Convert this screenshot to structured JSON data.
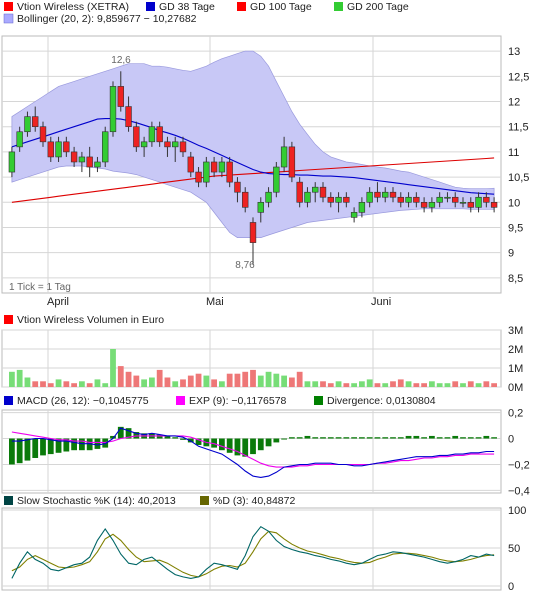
{
  "legends": {
    "price": [
      {
        "color": "#ff0000",
        "label": "Vtion Wireless (XETRA)"
      },
      {
        "color": "#0000cc",
        "label": "GD 38 Tage"
      },
      {
        "color": "#ff0000",
        "label": "GD 100 Tage"
      },
      {
        "color": "#33cc33",
        "label": "GD 200 Tage"
      },
      {
        "color": "#aaaaff",
        "label": "Bollinger (20, 2): 9,859677 − 10,27682"
      }
    ],
    "volume": [
      {
        "color": "#ff0000",
        "label": "Vtion Wireless Volumen in Euro"
      }
    ],
    "macd": [
      {
        "color": "#0000cc",
        "label": "MACD (26, 12): −0,1045775"
      },
      {
        "color": "#ff00ff",
        "label": "EXP (9): −0,1176578"
      },
      {
        "color": "#008000",
        "label": "Divergence: 0,0130804"
      }
    ],
    "stoch": [
      {
        "color": "#004444",
        "label": "Slow Stochastic %K (14): 40,2013"
      },
      {
        "color": "#666600",
        "label": "%D (3): 40,84872"
      }
    ]
  },
  "x_axis": {
    "months": [
      "April",
      "Mai",
      "Juni"
    ]
  },
  "price_axis": {
    "ticks": [
      "13",
      "12,5",
      "12",
      "11,5",
      "11",
      "10,5",
      "10",
      "9,5",
      "9",
      "8,5"
    ]
  },
  "annotations": {
    "high": "12,6",
    "low": "8,76",
    "tick_note": "1 Tick = 1 Tag"
  },
  "volume_axis": {
    "ticks": [
      "3M",
      "2M",
      "1M",
      "0M"
    ]
  },
  "macd_axis": {
    "ticks": [
      "0,2",
      "0",
      "−0,2",
      "−0,4"
    ]
  },
  "stoch_axis": {
    "ticks": [
      "100",
      "50",
      "0"
    ]
  },
  "chart_data": [
    {
      "type": "candlestick",
      "title": "Vtion Wireless (XETRA)",
      "ylim": [
        8.2,
        13.3
      ],
      "candles": [
        [
          10.6,
          11.1,
          10.5,
          11.0
        ],
        [
          11.1,
          11.5,
          11.0,
          11.4
        ],
        [
          11.4,
          11.8,
          11.3,
          11.7
        ],
        [
          11.7,
          11.9,
          11.4,
          11.5
        ],
        [
          11.5,
          11.6,
          11.1,
          11.2
        ],
        [
          11.2,
          11.3,
          10.8,
          10.9
        ],
        [
          10.9,
          11.3,
          10.8,
          11.2
        ],
        [
          11.2,
          11.3,
          10.9,
          11.0
        ],
        [
          11.0,
          11.1,
          10.7,
          10.8
        ],
        [
          10.8,
          11.0,
          10.6,
          10.9
        ],
        [
          10.9,
          11.1,
          10.5,
          10.7
        ],
        [
          10.7,
          10.9,
          10.6,
          10.8
        ],
        [
          10.8,
          11.5,
          10.7,
          11.4
        ],
        [
          11.4,
          12.4,
          11.3,
          12.3
        ],
        [
          12.3,
          12.6,
          11.8,
          11.9
        ],
        [
          11.9,
          12.1,
          11.4,
          11.5
        ],
        [
          11.5,
          11.6,
          11.0,
          11.1
        ],
        [
          11.1,
          11.3,
          10.9,
          11.2
        ],
        [
          11.2,
          11.6,
          11.1,
          11.5
        ],
        [
          11.5,
          11.6,
          11.1,
          11.2
        ],
        [
          11.2,
          11.3,
          10.9,
          11.1
        ],
        [
          11.1,
          11.3,
          10.8,
          11.2
        ],
        [
          11.2,
          11.3,
          10.9,
          11.0
        ],
        [
          10.9,
          11.0,
          10.5,
          10.6
        ],
        [
          10.6,
          10.7,
          10.3,
          10.4
        ],
        [
          10.4,
          10.9,
          10.3,
          10.8
        ],
        [
          10.8,
          10.9,
          10.5,
          10.6
        ],
        [
          10.6,
          10.9,
          10.5,
          10.8
        ],
        [
          10.8,
          10.9,
          10.3,
          10.4
        ],
        [
          10.4,
          10.5,
          10.0,
          10.2
        ],
        [
          10.2,
          10.3,
          9.8,
          9.9
        ],
        [
          9.6,
          9.7,
          8.76,
          9.2
        ],
        [
          9.8,
          10.1,
          9.6,
          10.0
        ],
        [
          10.0,
          10.3,
          9.9,
          10.2
        ],
        [
          10.2,
          10.8,
          10.1,
          10.7
        ],
        [
          10.7,
          11.3,
          10.6,
          11.1
        ],
        [
          11.1,
          11.2,
          10.4,
          10.5
        ],
        [
          10.4,
          10.5,
          9.9,
          10.0
        ],
        [
          10.0,
          10.3,
          9.9,
          10.2
        ],
        [
          10.2,
          10.4,
          10.0,
          10.3
        ],
        [
          10.3,
          10.4,
          10.0,
          10.1
        ],
        [
          10.1,
          10.2,
          9.9,
          10.0
        ],
        [
          10.0,
          10.2,
          9.8,
          10.1
        ],
        [
          10.1,
          10.2,
          9.9,
          10.0
        ],
        [
          9.7,
          9.9,
          9.6,
          9.8
        ],
        [
          9.8,
          10.1,
          9.7,
          10.0
        ],
        [
          10.0,
          10.3,
          9.9,
          10.2
        ],
        [
          10.2,
          10.4,
          10.0,
          10.1
        ],
        [
          10.1,
          10.3,
          10.0,
          10.2
        ],
        [
          10.2,
          10.3,
          10.0,
          10.1
        ],
        [
          10.1,
          10.2,
          9.9,
          10.0
        ],
        [
          10.0,
          10.2,
          9.9,
          10.1
        ],
        [
          10.1,
          10.2,
          9.9,
          10.0
        ],
        [
          10.0,
          10.1,
          9.8,
          9.9
        ],
        [
          9.9,
          10.1,
          9.8,
          10.0
        ],
        [
          10.0,
          10.2,
          9.9,
          10.1
        ],
        [
          10.1,
          10.2,
          10.0,
          10.1
        ],
        [
          10.1,
          10.2,
          9.9,
          10.0
        ],
        [
          10.0,
          10.1,
          9.9,
          10.0
        ],
        [
          10.0,
          10.1,
          9.8,
          9.9
        ],
        [
          9.9,
          10.2,
          9.8,
          10.1
        ],
        [
          10.1,
          10.2,
          9.9,
          10.0
        ],
        [
          10.0,
          10.1,
          9.8,
          9.9
        ]
      ],
      "gd38": [
        11.1,
        11.15,
        11.2,
        11.25,
        11.3,
        11.35,
        11.4,
        11.45,
        11.5,
        11.55,
        11.6,
        11.65,
        11.66,
        11.66,
        11.65,
        11.62,
        11.58,
        11.53,
        11.48,
        11.42,
        11.38,
        11.33,
        11.27,
        11.2,
        11.13,
        11.07,
        11.0,
        10.93,
        10.86,
        10.79,
        10.72,
        10.65,
        10.6,
        10.57,
        10.56,
        10.55,
        10.55,
        10.54,
        10.54,
        10.53,
        10.52,
        10.52,
        10.51,
        10.5,
        10.49,
        10.47,
        10.45,
        10.43,
        10.41,
        10.39,
        10.37,
        10.35,
        10.33,
        10.31,
        10.29,
        10.27,
        10.25,
        10.23,
        10.21,
        10.19,
        10.18,
        10.17,
        10.16
      ],
      "gd100": [
        10.0,
        10.02,
        10.04,
        10.06,
        10.08,
        10.1,
        10.12,
        10.14,
        10.16,
        10.18,
        10.2,
        10.22,
        10.24,
        10.26,
        10.28,
        10.3,
        10.32,
        10.34,
        10.36,
        10.38,
        10.4,
        10.42,
        10.44,
        10.46,
        10.48,
        10.5,
        10.52,
        10.53,
        10.54,
        10.55,
        10.56,
        10.57,
        10.58,
        10.59,
        10.6,
        10.61,
        10.62,
        10.63,
        10.64,
        10.65,
        10.66,
        10.67,
        10.68,
        10.69,
        10.7,
        10.71,
        10.72,
        10.73,
        10.74,
        10.75,
        10.76,
        10.77,
        10.78,
        10.79,
        10.8,
        10.81,
        10.82,
        10.83,
        10.84,
        10.85,
        10.86,
        10.87,
        10.88
      ],
      "boll_upper": [
        11.7,
        11.8,
        11.9,
        12.0,
        12.1,
        12.2,
        12.3,
        12.35,
        12.4,
        12.45,
        12.5,
        12.55,
        12.6,
        12.65,
        12.7,
        12.75,
        12.75,
        12.75,
        12.7,
        12.7,
        12.68,
        12.65,
        12.62,
        12.6,
        12.65,
        12.7,
        12.78,
        12.85,
        12.9,
        12.95,
        13.0,
        13.0,
        12.9,
        12.7,
        12.4,
        12.1,
        11.8,
        11.55,
        11.35,
        11.15,
        11.0,
        10.9,
        10.85,
        10.8,
        10.78,
        10.75,
        10.72,
        10.7,
        10.68,
        10.65,
        10.62,
        10.6,
        10.55,
        10.5,
        10.45,
        10.4,
        10.35,
        10.3,
        10.28,
        10.27,
        10.27,
        10.27,
        10.28
      ],
      "boll_lower": [
        10.4,
        10.45,
        10.5,
        10.55,
        10.6,
        10.65,
        10.7,
        10.72,
        10.72,
        10.72,
        10.7,
        10.68,
        10.66,
        10.62,
        10.6,
        10.58,
        10.55,
        10.5,
        10.45,
        10.4,
        10.35,
        10.3,
        10.25,
        10.2,
        10.1,
        10.0,
        9.8,
        9.6,
        9.4,
        9.3,
        9.3,
        9.3,
        9.3,
        9.35,
        9.4,
        9.45,
        9.5,
        9.55,
        9.6,
        9.62,
        9.64,
        9.66,
        9.68,
        9.7,
        9.72,
        9.74,
        9.76,
        9.78,
        9.8,
        9.82,
        9.84,
        9.85,
        9.86,
        9.87,
        9.87,
        9.87,
        9.87,
        9.87,
        9.87,
        9.86,
        9.86,
        9.86,
        9.86
      ]
    },
    {
      "type": "bar",
      "title": "Vtion Wireless Volumen in Euro",
      "ylim": [
        0,
        3
      ],
      "values": [
        0.8,
        0.9,
        0.5,
        0.3,
        0.3,
        0.2,
        0.4,
        0.3,
        0.2,
        0.3,
        0.2,
        0.4,
        0.2,
        2.0,
        1.1,
        0.8,
        0.6,
        0.4,
        0.5,
        0.9,
        0.5,
        0.3,
        0.4,
        0.6,
        0.7,
        0.6,
        0.4,
        0.3,
        0.7,
        0.7,
        0.8,
        0.9,
        0.6,
        0.8,
        0.7,
        0.6,
        0.5,
        0.8,
        0.3,
        0.3,
        0.3,
        0.2,
        0.3,
        0.2,
        0.2,
        0.3,
        0.4,
        0.2,
        0.2,
        0.3,
        0.4,
        0.3,
        0.2,
        0.2,
        0.3,
        0.2,
        0.2,
        0.3,
        0.2,
        0.3,
        0.2,
        0.3,
        0.2
      ],
      "up": [
        1,
        1,
        1,
        0,
        0,
        0,
        1,
        0,
        0,
        1,
        0,
        1,
        1,
        1,
        0,
        0,
        0,
        1,
        1,
        0,
        0,
        1,
        0,
        0,
        0,
        1,
        0,
        1,
        0,
        0,
        0,
        0,
        1,
        1,
        1,
        1,
        0,
        0,
        1,
        1,
        0,
        0,
        1,
        0,
        1,
        1,
        1,
        0,
        1,
        0,
        0,
        1,
        0,
        0,
        1,
        1,
        1,
        0,
        1,
        0,
        1,
        0,
        0
      ]
    },
    {
      "type": "line",
      "title": "MACD (26, 12)",
      "ylim": [
        -0.42,
        0.22
      ],
      "macd": [
        -0.02,
        -0.02,
        -0.01,
        0.0,
        0.0,
        -0.01,
        -0.02,
        -0.02,
        -0.03,
        -0.04,
        -0.04,
        -0.05,
        -0.04,
        0.0,
        0.08,
        0.06,
        0.04,
        0.03,
        0.04,
        0.03,
        0.02,
        0.02,
        0.01,
        -0.02,
        -0.06,
        -0.08,
        -0.1,
        -0.12,
        -0.16,
        -0.2,
        -0.25,
        -0.29,
        -0.3,
        -0.29,
        -0.26,
        -0.22,
        -0.21,
        -0.2,
        -0.2,
        -0.19,
        -0.19,
        -0.19,
        -0.2,
        -0.2,
        -0.21,
        -0.21,
        -0.2,
        -0.19,
        -0.18,
        -0.17,
        -0.16,
        -0.15,
        -0.14,
        -0.14,
        -0.14,
        -0.13,
        -0.13,
        -0.12,
        -0.12,
        -0.11,
        -0.11,
        -0.1,
        -0.1
      ],
      "signal": [
        0.05,
        0.04,
        0.03,
        0.02,
        0.01,
        0.0,
        -0.01,
        -0.01,
        -0.02,
        -0.02,
        -0.03,
        -0.03,
        -0.03,
        -0.02,
        0.0,
        0.01,
        0.02,
        0.02,
        0.02,
        0.02,
        0.02,
        0.02,
        0.02,
        0.01,
        -0.01,
        -0.03,
        -0.04,
        -0.06,
        -0.08,
        -0.1,
        -0.13,
        -0.16,
        -0.19,
        -0.21,
        -0.22,
        -0.22,
        -0.22,
        -0.21,
        -0.21,
        -0.2,
        -0.2,
        -0.2,
        -0.2,
        -0.2,
        -0.2,
        -0.2,
        -0.2,
        -0.19,
        -0.19,
        -0.18,
        -0.17,
        -0.17,
        -0.16,
        -0.15,
        -0.15,
        -0.14,
        -0.14,
        -0.13,
        -0.13,
        -0.12,
        -0.12,
        -0.12,
        -0.12
      ],
      "divergence": [
        -0.2,
        -0.19,
        -0.17,
        -0.15,
        -0.13,
        -0.12,
        -0.11,
        -0.1,
        -0.09,
        -0.09,
        -0.09,
        -0.08,
        -0.07,
        0.02,
        0.09,
        0.08,
        0.05,
        0.04,
        0.04,
        0.03,
        0.02,
        0.01,
        -0.01,
        -0.03,
        -0.05,
        -0.06,
        -0.07,
        -0.09,
        -0.11,
        -0.13,
        -0.14,
        -0.12,
        -0.09,
        -0.06,
        -0.03,
        0.0,
        0.01,
        0.01,
        0.02,
        0.01,
        0.01,
        0.01,
        0.01,
        0.01,
        0.01,
        0.01,
        0.01,
        0.01,
        0.01,
        0.01,
        0.01,
        0.02,
        0.02,
        0.01,
        0.02,
        0.01,
        0.01,
        0.02,
        0.01,
        0.01,
        0.01,
        0.02,
        0.01
      ]
    },
    {
      "type": "line",
      "title": "Slow Stochastic",
      "ylim": [
        0,
        100
      ],
      "k": [
        10,
        30,
        45,
        35,
        30,
        22,
        20,
        24,
        28,
        30,
        38,
        60,
        75,
        60,
        42,
        30,
        28,
        35,
        38,
        30,
        22,
        15,
        12,
        10,
        12,
        22,
        30,
        28,
        25,
        22,
        40,
        65,
        78,
        72,
        60,
        52,
        48,
        45,
        43,
        40,
        38,
        35,
        33,
        30,
        28,
        30,
        35,
        40,
        42,
        45,
        44,
        42,
        40,
        38,
        35,
        32,
        30,
        32,
        35,
        40,
        38,
        42,
        40
      ],
      "d": [
        20,
        25,
        35,
        40,
        35,
        30,
        25,
        24,
        25,
        28,
        32,
        45,
        62,
        68,
        60,
        48,
        38,
        32,
        33,
        34,
        30,
        24,
        18,
        14,
        12,
        16,
        22,
        26,
        27,
        25,
        30,
        45,
        62,
        72,
        70,
        62,
        55,
        50,
        46,
        44,
        41,
        38,
        36,
        33,
        31,
        30,
        31,
        35,
        38,
        42,
        43,
        43,
        42,
        40,
        38,
        35,
        33,
        32,
        33,
        35,
        38,
        40,
        41
      ]
    }
  ]
}
